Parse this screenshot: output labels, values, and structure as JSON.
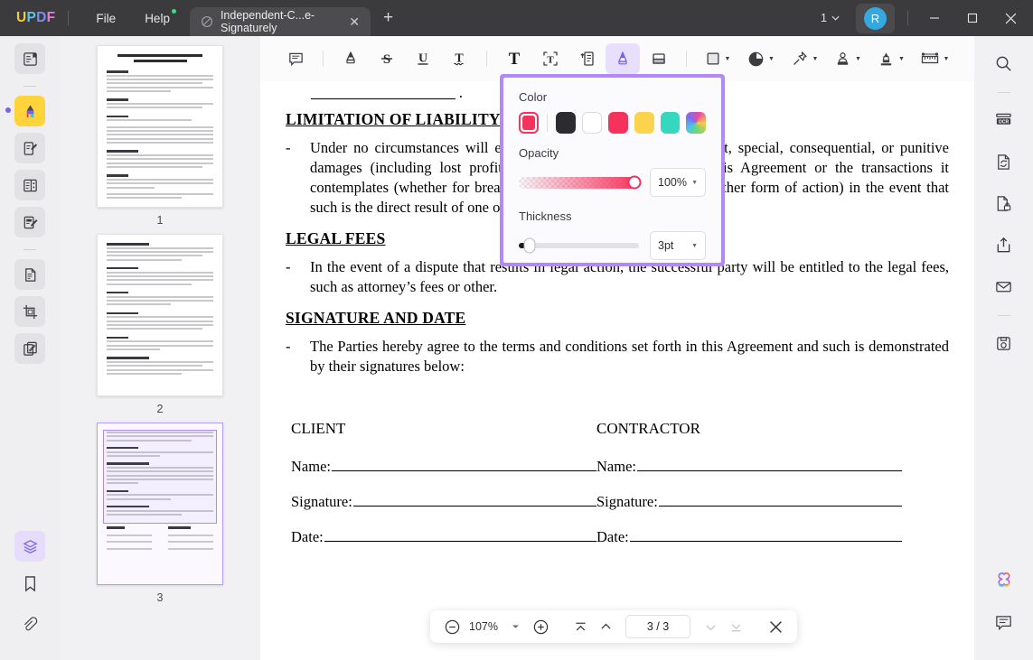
{
  "titlebar": {
    "logo": [
      "U",
      "P",
      "D",
      "F"
    ],
    "menus": [
      {
        "label": "File",
        "badge": false
      },
      {
        "label": "Help",
        "badge": true
      }
    ],
    "tab": {
      "title": "Independent-C...e-Signaturely",
      "icon": "document-slash-icon",
      "close": "✕"
    },
    "new_tab": "+",
    "window_count": "1",
    "avatar_initial": "R",
    "window_controls": {
      "minimize": "—",
      "maximize": "□",
      "close": "✕"
    }
  },
  "left_rail": {
    "items": [
      {
        "name": "reader-mode",
        "icon": "book-reader-icon",
        "state": "default"
      },
      {
        "name": "annotate",
        "icon": "highlighter-icon",
        "state": "active-yellow"
      },
      {
        "name": "edit-pdf",
        "icon": "edit-pen-icon",
        "state": "default"
      },
      {
        "name": "organize-pages",
        "icon": "page-organize-icon",
        "state": "default"
      },
      {
        "name": "fill-and-sign",
        "icon": "sign-doc-icon",
        "state": "default"
      },
      {
        "name": "convert",
        "icon": "convert-doc-icon",
        "state": "default"
      },
      {
        "name": "crop",
        "icon": "crop-icon",
        "state": "default"
      },
      {
        "name": "compare",
        "icon": "compare-pages-icon",
        "state": "default"
      }
    ],
    "bottom": [
      {
        "name": "layers",
        "icon": "layers-icon",
        "state": "active-purple"
      },
      {
        "name": "bookmarks",
        "icon": "bookmark-icon",
        "state": "plain"
      },
      {
        "name": "attachments",
        "icon": "paperclip-icon",
        "state": "plain"
      }
    ]
  },
  "thumbnails": [
    {
      "number": "1",
      "selected": false,
      "title": "INDEPENDENT CONTRACT AGREEMENT"
    },
    {
      "number": "2",
      "selected": false,
      "title": ""
    },
    {
      "number": "3",
      "selected": true,
      "title": ""
    }
  ],
  "toolbar": {
    "tools": [
      {
        "name": "sticky-note",
        "icon": "comment-icon",
        "active": false,
        "caret": false
      },
      {
        "name": "highlight",
        "icon": "highlighter-icon",
        "active": false,
        "caret": false
      },
      {
        "name": "strikethrough",
        "icon": "strikethrough-s-icon",
        "active": false,
        "caret": false
      },
      {
        "name": "underline",
        "icon": "underline-u-icon",
        "active": false,
        "caret": false
      },
      {
        "name": "squiggly-underline",
        "icon": "squiggly-t-icon",
        "active": false,
        "caret": false
      },
      {
        "name": "add-text",
        "icon": "text-t-icon",
        "active": false,
        "caret": false
      },
      {
        "name": "text-box",
        "icon": "textbox-icon",
        "active": false,
        "caret": false
      },
      {
        "name": "text-callout",
        "icon": "callout-icon",
        "active": false,
        "caret": false
      },
      {
        "name": "pencil",
        "icon": "pen-marker-icon",
        "active": true,
        "caret": false
      },
      {
        "name": "eraser",
        "icon": "eraser-icon",
        "active": false,
        "caret": false
      },
      {
        "name": "shapes",
        "icon": "square-shape-icon",
        "active": false,
        "caret": true
      },
      {
        "name": "stickers",
        "icon": "sticker-circle-icon",
        "active": false,
        "caret": true
      },
      {
        "name": "pin-stamp",
        "icon": "pushpin-icon",
        "active": false,
        "caret": true
      },
      {
        "name": "stamp",
        "icon": "stamp-person-icon",
        "active": false,
        "caret": true
      },
      {
        "name": "signature",
        "icon": "signature-pen-icon",
        "active": false,
        "caret": true
      },
      {
        "name": "measure",
        "icon": "ruler-icon",
        "active": false,
        "caret": true
      }
    ]
  },
  "popup": {
    "color_label": "Color",
    "colors": [
      {
        "name": "selected-rose",
        "hex": "#f5325b",
        "selected": true
      },
      {
        "name": "black",
        "hex": "#2b2b30",
        "selected": false
      },
      {
        "name": "white",
        "hex": "#ffffff",
        "selected": false
      },
      {
        "name": "rose",
        "hex": "#f5325b",
        "selected": false
      },
      {
        "name": "yellow",
        "hex": "#fbd34d",
        "selected": false
      },
      {
        "name": "teal",
        "hex": "#35d7be",
        "selected": false
      },
      {
        "name": "custom-rainbow",
        "hex": "rainbow",
        "selected": false
      }
    ],
    "opacity_label": "Opacity",
    "opacity_value": "100%",
    "thickness_label": "Thickness",
    "thickness_value": "3pt"
  },
  "document": {
    "sections": [
      {
        "heading": "LIMITATION OF LIABILITY",
        "bullet_marker": "-",
        "body": "Under no circumstances will either party be liable for any indirect, special, consequential, or punitive damages (including lost profits) arising out of or relating to this Agreement or the transactions it contemplates (whether for breach of contract, tort, negligence, or other form of action) in the event that such is the direct result of one of the Parties’ negligence or breach."
      },
      {
        "heading": "LEGAL FEES",
        "bullet_marker": "-",
        "body": "In the event of a dispute that results in legal action, the successful party will be entitled to the legal fees, such as attorney’s fees or other."
      },
      {
        "heading": "SIGNATURE AND DATE",
        "bullet_marker": "-",
        "body": "The Parties hereby agree to the terms and conditions set forth in this Agreement and such is demonstrated by their signatures below:"
      }
    ],
    "signature_block": {
      "client": {
        "title": "CLIENT",
        "fields": [
          "Name:",
          "Signature:",
          "Date:"
        ]
      },
      "contractor": {
        "title": "CONTRACTOR",
        "fields": [
          "Name:",
          "Signature:",
          "Date:"
        ]
      }
    }
  },
  "zoombar": {
    "zoom_out": "−",
    "zoom_level": "107%",
    "zoom_in": "+",
    "first_page": "first-page",
    "prev_page": "prev-page",
    "page_indicator": "3 / 3",
    "next_page": "next-page",
    "last_page": "last-page",
    "close": "✕"
  },
  "right_rail": {
    "items": [
      {
        "name": "search",
        "icon": "search-icon"
      },
      {
        "name": "ocr",
        "icon": "ocr-icon"
      },
      {
        "name": "convert",
        "icon": "convert-sync-icon"
      },
      {
        "name": "protect",
        "icon": "lock-doc-icon"
      },
      {
        "name": "share",
        "icon": "share-upload-icon"
      },
      {
        "name": "email",
        "icon": "envelope-icon"
      },
      {
        "name": "save",
        "icon": "save-disk-icon"
      }
    ],
    "bottom": [
      {
        "name": "ai-assistant",
        "icon": "ai-flower-icon"
      },
      {
        "name": "comments-panel",
        "icon": "comment-icon"
      }
    ]
  },
  "colors": {
    "accent_purple": "#b388f9",
    "titlebar_bg": "#3b3b3d",
    "active_yellow": "#ffd43b",
    "rose": "#f5325b"
  }
}
